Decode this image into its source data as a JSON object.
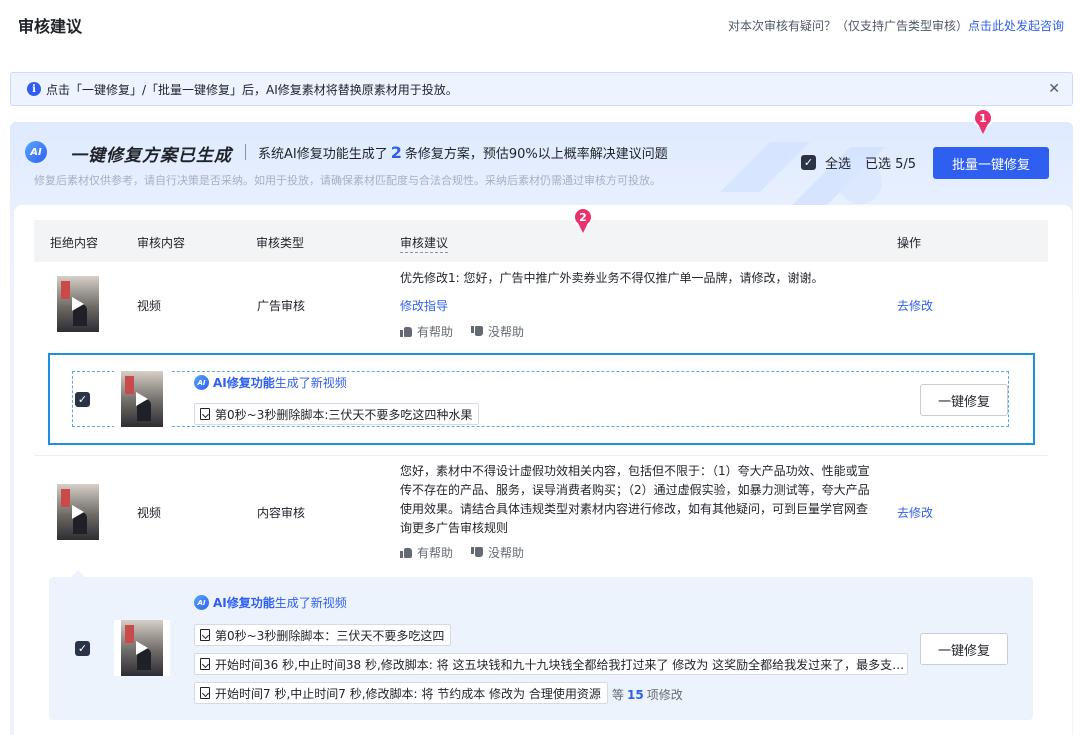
{
  "header": {
    "title": "审核建议",
    "question": "对本次审核有疑问？（仅支持广告类型审核）",
    "consult_link": "点击此处发起咨询"
  },
  "notice": {
    "text": "点击「一键修复」/「批量一键修复」后，AI修复素材将替换原素材用于投放。"
  },
  "panel": {
    "ai_badge": "AI",
    "title": "一键修复方案已生成",
    "desc_prefix": "系统AI修复功能生成了",
    "desc_count": "2",
    "desc_suffix": "条修复方案，预估90%以上概率解决建议问题",
    "sub": "修复后素材仅供参考，请自行决策是否采纳。如用于投放，请确保素材匹配度与合法合规性。采纳后素材仍需通过审核方可投放。",
    "select_all": "全选",
    "selected": "已选 5/5",
    "batch_button": "批量一键修复"
  },
  "markers": [
    "1",
    "2"
  ],
  "table": {
    "headers": [
      "拒绝内容",
      "审核内容",
      "审核类型",
      "审核建议",
      "操作"
    ]
  },
  "rows": [
    {
      "content": "视频",
      "type": "广告审核",
      "suggestion": "优先修改1: 您好，广告中推广外卖券业务不得仅推广单一品牌，请修改，谢谢。",
      "guide": "修改指导",
      "helpful": "有帮助",
      "unhelpful": "没帮助",
      "action": "去修改"
    },
    {
      "content": "视频",
      "type": "内容审核",
      "suggestion": "您好，素材中不得设计虚假功效相关内容，包括但不限于：（1）夸大产品功效、性能或宣传不存在的产品、服务，误导消费者购买；（2）通过虚假实验，如暴力测试等，夸大产品使用效果。请结合具体违规类型对素材内容进行修改，如有其他疑问，可到巨量学官网查询更多广告审核规则",
      "helpful": "有帮助",
      "unhelpful": "没帮助",
      "action": "去修改"
    }
  ],
  "ai_fixes": [
    {
      "title_bold": "AI修复功能",
      "title_rest": "生成了新视频",
      "items": [
        "第0秒~3秒删除脚本:三伏天不要多吃这四种水果"
      ],
      "button": "一键修复"
    },
    {
      "title_bold": "AI修复功能",
      "title_rest": "生成了新视频",
      "items": [
        "第0秒~3秒删除脚本：三伏天不要多吃这四",
        "开始时间36 秒,中止时间38 秒,修改脚本: 将 这五块钱和九十九块钱全都给我打过来了 修改为 这奖励全都给我发过来了，最多支…",
        "开始时间7 秒,中止时间7 秒,修改脚本: 将 节约成本 修改为 合理使用资源"
      ],
      "more_prefix": "等",
      "more_count": "15",
      "more_suffix": "项修改",
      "button": "一键修复"
    }
  ],
  "colors": {
    "accent": "#2f5ff0",
    "marker": "#e8336e",
    "highlight": "#1a8fe3"
  }
}
